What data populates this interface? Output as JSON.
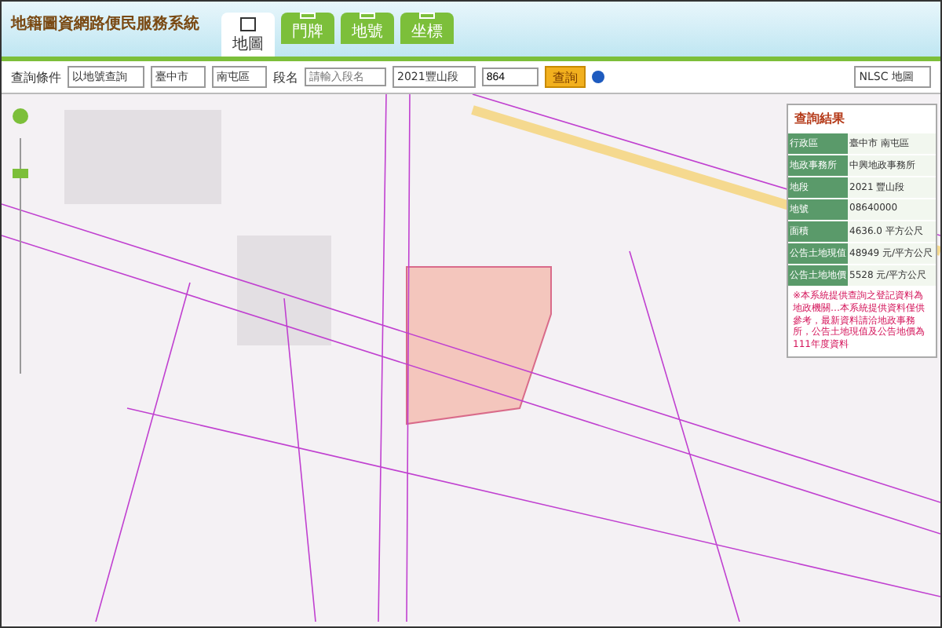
{
  "app_title": "地籍圖資網路便民服務系統",
  "tabs": [
    {
      "label": "地圖",
      "selected": true
    },
    {
      "label": "門牌",
      "selected": false
    },
    {
      "label": "地號",
      "selected": false
    },
    {
      "label": "坐標",
      "selected": false
    }
  ],
  "query": {
    "label": "查詢條件",
    "mode": "以地號查詢",
    "city": "臺中市",
    "district": "南屯區",
    "section_label": "段名",
    "section_placeholder": "請輸入段名",
    "section": "2021豐山段",
    "parcel": "864",
    "button": "查詢"
  },
  "basemap": "NLSC 地圖",
  "zoom": {
    "level": 0.85
  },
  "result": {
    "title": "查詢結果",
    "rows": [
      {
        "label": "行政區",
        "value": "臺中市 南屯區"
      },
      {
        "label": "地政事務所",
        "value": "中興地政事務所"
      },
      {
        "label": "地段",
        "value": "2021 豐山段"
      },
      {
        "label": "地號",
        "value": "08640000"
      },
      {
        "label": "面積",
        "value": "4636.0 平方公尺"
      },
      {
        "label": "公告土地現值",
        "value": "48949 元/平方公尺"
      },
      {
        "label": "公告土地地價",
        "value": "5528 元/平方公尺"
      }
    ],
    "note": "※本系統提供查詢之登記資料為地政機關…本系統提供資料僅供參考，最新資料請洽地政事務所，公告土地現值及公告地價為111年度資料"
  }
}
